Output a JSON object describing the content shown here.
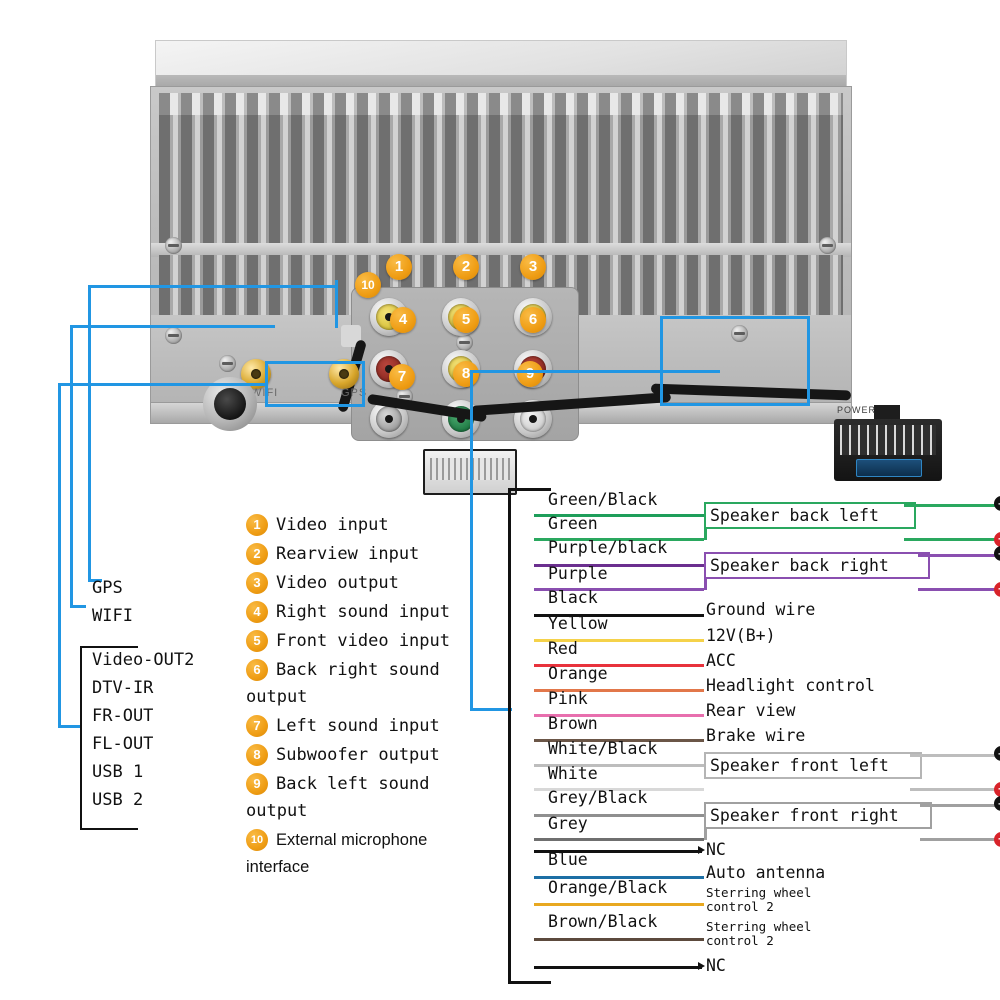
{
  "device": {
    "power_connector_label": "POWER",
    "antenna_labels": {
      "wifi": "WIFI",
      "gps": "GPS"
    },
    "rca_jacks": [
      {
        "n": "1",
        "color": "yellow"
      },
      {
        "n": "2",
        "color": "yellow"
      },
      {
        "n": "3",
        "color": "yellow"
      },
      {
        "n": "4",
        "color": "red"
      },
      {
        "n": "5",
        "color": "yellow"
      },
      {
        "n": "6",
        "color": "red"
      },
      {
        "n": "7",
        "color": "dark"
      },
      {
        "n": "8",
        "color": "green"
      },
      {
        "n": "9",
        "color": "white"
      },
      {
        "n": "10",
        "color": "mic"
      }
    ]
  },
  "left_labels": {
    "gps": "GPS",
    "wifi": "WIFI",
    "group": [
      "Video-OUT2",
      "DTV-IR",
      "FR-OUT",
      "FL-OUT",
      "USB 1",
      "USB 2"
    ]
  },
  "legend": [
    {
      "n": "1",
      "text": "Video input"
    },
    {
      "n": "2",
      "text": "Rearview input"
    },
    {
      "n": "3",
      "text": "Video output"
    },
    {
      "n": "4",
      "text": "Right sound input"
    },
    {
      "n": "5",
      "text": "Front video input"
    },
    {
      "n": "6",
      "text": "Back right sound\noutput"
    },
    {
      "n": "7",
      "text": "Left sound input"
    },
    {
      "n": "8",
      "text": "Subwoofer output"
    },
    {
      "n": "9",
      "text": "Back left sound\noutput"
    },
    {
      "n": "10",
      "text": "External microphone\n      interface"
    }
  ],
  "harness": {
    "wires": [
      {
        "name": "Green/Black",
        "color": "#1e9e5a",
        "function": "",
        "group": "speaker-back-left",
        "polarity": "-"
      },
      {
        "name": "Green",
        "color": "#2aa85f",
        "function": "",
        "group": "speaker-back-left",
        "polarity": "+"
      },
      {
        "name": "Purple/black",
        "color": "#6b2f8f",
        "function": "",
        "group": "speaker-back-right",
        "polarity": "-"
      },
      {
        "name": "Purple",
        "color": "#8a4fb0",
        "function": "",
        "group": "speaker-back-right",
        "polarity": "+"
      },
      {
        "name": "Black",
        "color": "#111111",
        "function": "Ground wire",
        "group": "",
        "polarity": ""
      },
      {
        "name": "Yellow",
        "color": "#f5d24a",
        "function": "12V(B+)",
        "group": "",
        "polarity": ""
      },
      {
        "name": "Red",
        "color": "#e8323c",
        "function": "ACC",
        "group": "",
        "polarity": ""
      },
      {
        "name": "Orange",
        "color": "#e2774a",
        "function": "Headlight control",
        "group": "",
        "polarity": ""
      },
      {
        "name": "Pink",
        "color": "#e86fae",
        "function": "Rear view",
        "group": "",
        "polarity": ""
      },
      {
        "name": "Brown",
        "color": "#6b5647",
        "function": "Brake wire",
        "group": "",
        "polarity": ""
      },
      {
        "name": "White/Black",
        "color": "#9a9a9a",
        "function": "",
        "group": "speaker-front-left",
        "polarity": "-"
      },
      {
        "name": "White",
        "color": "#cfcfcf",
        "function": "",
        "group": "speaker-front-left",
        "polarity": "+"
      },
      {
        "name": "Grey/Black",
        "color": "#8f8f8f",
        "function": "",
        "group": "speaker-front-right",
        "polarity": "-"
      },
      {
        "name": "Grey",
        "color": "#6f6f6f",
        "function": "",
        "group": "speaker-front-right",
        "polarity": "+"
      },
      {
        "name": "",
        "color": "#111111",
        "function": "NC",
        "group": "",
        "polarity": ""
      },
      {
        "name": "Blue",
        "color": "#1d6fa5",
        "function": "Auto antenna",
        "group": "",
        "polarity": ""
      },
      {
        "name": "Orange/Black",
        "color": "#e8a820",
        "function": "Sterring wheel\ncontrol 2",
        "group": "",
        "polarity": ""
      },
      {
        "name": "Brown/Black",
        "color": "#5c4a3d",
        "function": "Sterring wheel\ncontrol 2",
        "group": "",
        "polarity": ""
      },
      {
        "name": "",
        "color": "#111111",
        "function": "NC",
        "group": "",
        "polarity": ""
      }
    ],
    "speakers": [
      {
        "label": "Speaker back left",
        "color": "#2aa85f"
      },
      {
        "label": "Speaker back right",
        "color": "#8a4fb0"
      },
      {
        "label": "Speaker front left",
        "color": "#b5b5b5"
      },
      {
        "label": "Speaker front right",
        "color": "#a0a0a0"
      }
    ],
    "polarity_symbols": {
      "minus": "—",
      "plus": "+"
    }
  },
  "colors": {
    "accent_badge": "#ef9d14",
    "leader_blue": "#2196E3",
    "plus": "#d8232a",
    "minus": "#111111"
  }
}
